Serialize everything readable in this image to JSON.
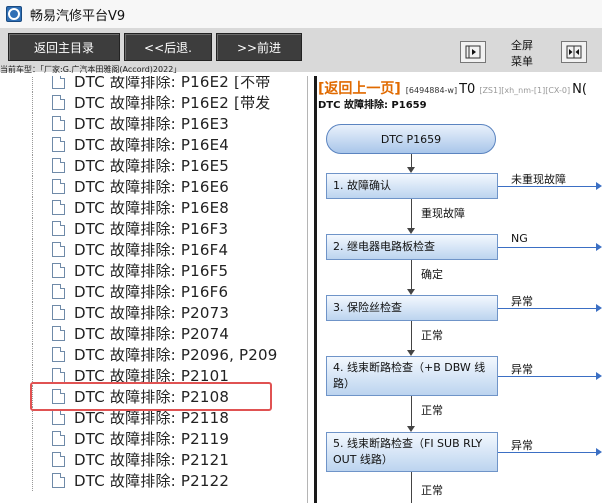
{
  "window": {
    "title": "畅易汽修平台V9"
  },
  "toolbar": {
    "home_label": "返回主目录",
    "back_label": "<<后退.",
    "forward_label": ">>前进",
    "fullscreen_label_1": "全屏",
    "fullscreen_label_2": "菜单"
  },
  "car_line": "当前车型：「厂家:G.广汽本田雅阁(Accord)2022」",
  "tree": {
    "items": [
      "DTC 故障排除: P16E2 [不带",
      "DTC 故障排除: P16E2 [带发",
      "DTC 故障排除: P16E3",
      "DTC 故障排除: P16E4",
      "DTC 故障排除: P16E5",
      "DTC 故障排除: P16E6",
      "DTC 故障排除: P16E8",
      "DTC 故障排除: P16F3",
      "DTC 故障排除: P16F4",
      "DTC 故障排除: P16F5",
      "DTC 故障排除: P16F6",
      "DTC 故障排除: P2073",
      "DTC 故障排除: P2074",
      "DTC 故障排除: P2096, P209",
      "DTC 故障排除: P2101",
      "DTC 故障排除: P2108",
      "DTC 故障排除: P2118",
      "DTC 故障排除: P2119",
      "DTC 故障排除: P2121",
      "DTC 故障排除: P2122"
    ],
    "selected_index": 15
  },
  "content": {
    "back_link": "[返回上一页]",
    "code1": "[6494884-w]",
    "t0": "T0",
    "code2": "[ZS1][xh_nm-[1][CX-0]",
    "ng_top": "N(",
    "subtitle": "DTC 故障排除: P1659",
    "flow": {
      "start": "DTC P1659",
      "steps": [
        "1.  故障确认",
        "2.  继电器电路板检查",
        "3.  保险丝检查",
        "4.  线束断路检查（+B DBW 线路）",
        "5.  线束断路检查（FI SUB RLY OUT 线路）"
      ],
      "down_labels": [
        "重现故障",
        "确定",
        "正常",
        "正常",
        "正常"
      ],
      "side_labels": [
        "未重现故障",
        "NG",
        "异常",
        "异常",
        "异常"
      ]
    }
  },
  "colors": {
    "toolbar_button": "#3d3d3d",
    "back_link": "#e06a00",
    "highlight_border": "#e05252",
    "flow_arrow": "#3b6fc4"
  }
}
